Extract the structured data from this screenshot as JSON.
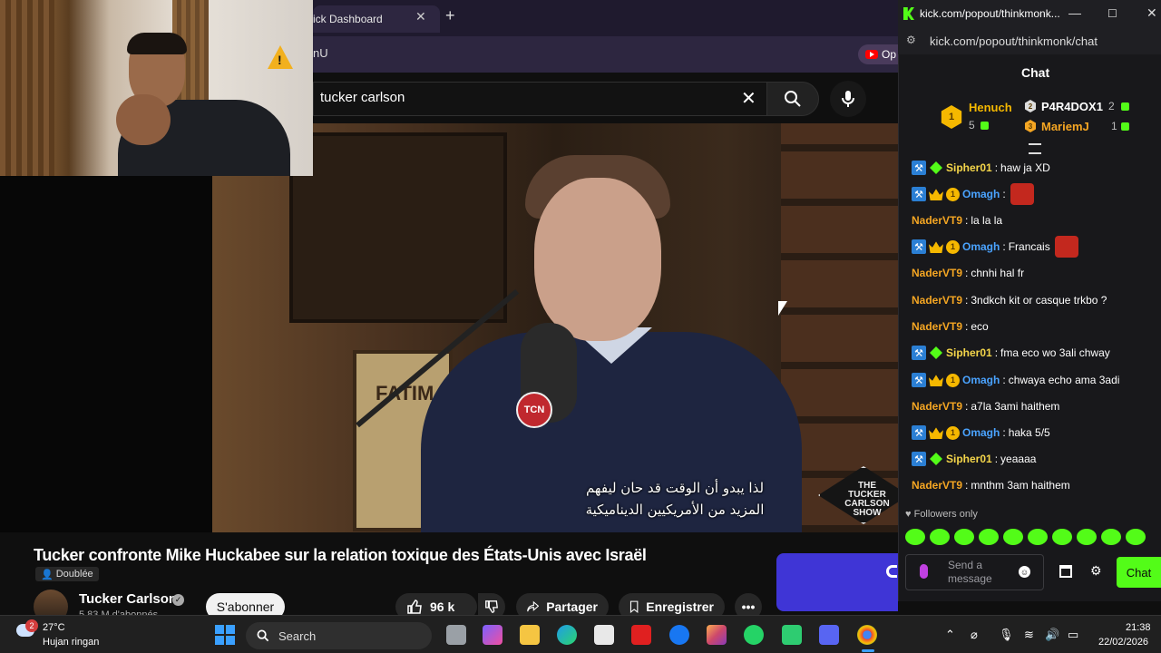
{
  "browser": {
    "tab_title": "ick Dashboard",
    "address_text": "nU",
    "yt_pill_label": "Op"
  },
  "youtube": {
    "search_value": "tucker carlson",
    "video": {
      "subtitle_line1": "لذا يبدو أن الوقت قد حان ليفهم",
      "subtitle_line2": "المزيد من الأمريكيين الديناميكية",
      "poster_text": "FATIM",
      "mic_badge": "TCN",
      "show_logo": "THE TUCKER CARLSON SHOW"
    },
    "title": "Tucker confronte Mike Huckabee sur la relation toxique des États-Unis avec Israël",
    "dubbed_label": "Doublée",
    "channel": {
      "name": "Tucker Carlson",
      "subscribers": "5,83 M d'abonnés",
      "subscribe_label": "S'abonner"
    },
    "actions": {
      "likes": "96 k",
      "share_label": "Partager",
      "save_label": "Enregistrer"
    }
  },
  "chat_window": {
    "title": "kick.com/popout/thinkmonk...",
    "url": "kick.com/popout/thinkmonk/chat",
    "header": "Chat",
    "leaderboard": [
      {
        "rank": "1",
        "name": "Henuch",
        "count": "5",
        "color": "#f5b800"
      },
      {
        "rank": "2",
        "name": "P4R4DOX1",
        "count": "2",
        "color": "#ffffff"
      },
      {
        "rank": "3",
        "name": "MariemJ",
        "count": "1",
        "color": "#f5a623"
      }
    ],
    "messages": [
      {
        "user": "Sipher01",
        "text": "haw ja XD",
        "color": "#f5d64a",
        "badges": "tool-gem"
      },
      {
        "user": "Omagh",
        "text": "",
        "color": "#4aa3ff",
        "badges": "tool-crown-one",
        "emote": true
      },
      {
        "user": "NaderVT9",
        "text": "la la la",
        "color": "#f5a623",
        "badges": ""
      },
      {
        "user": "Omagh",
        "text": "Francais",
        "color": "#4aa3ff",
        "badges": "tool-crown-one",
        "emote": true
      },
      {
        "user": "NaderVT9",
        "text": "chnhi hal fr",
        "color": "#f5a623",
        "badges": ""
      },
      {
        "user": "NaderVT9",
        "text": "3ndkch kit or casque trkbo ?",
        "color": "#f5a623",
        "badges": ""
      },
      {
        "user": "NaderVT9",
        "text": "eco",
        "color": "#f5a623",
        "badges": ""
      },
      {
        "user": "Sipher01",
        "text": "fma eco wo 3ali chway",
        "color": "#f5d64a",
        "badges": "tool-gem"
      },
      {
        "user": "Omagh",
        "text": "chwaya echo ama 3adi",
        "color": "#4aa3ff",
        "badges": "tool-crown-one"
      },
      {
        "user": "NaderVT9",
        "text": "a7la 3ami haithem",
        "color": "#f5a623",
        "badges": ""
      },
      {
        "user": "Omagh",
        "text": "haka 5/5",
        "color": "#4aa3ff",
        "badges": "tool-crown-one"
      },
      {
        "user": "Sipher01",
        "text": "yeaaaa",
        "color": "#f5d64a",
        "badges": "tool-gem"
      },
      {
        "user": "NaderVT9",
        "text": "mnthm 3am haithem",
        "color": "#f5a623",
        "badges": ""
      }
    ],
    "followers_only": "Followers only",
    "input_placeholder": "Send a message",
    "chat_button": "Chat"
  },
  "taskbar": {
    "weather_temp": "27°C",
    "weather_desc": "Hujan ringan",
    "weather_badge": "2",
    "search_label": "Search",
    "time": "21:38",
    "date": "22/02/2026"
  }
}
